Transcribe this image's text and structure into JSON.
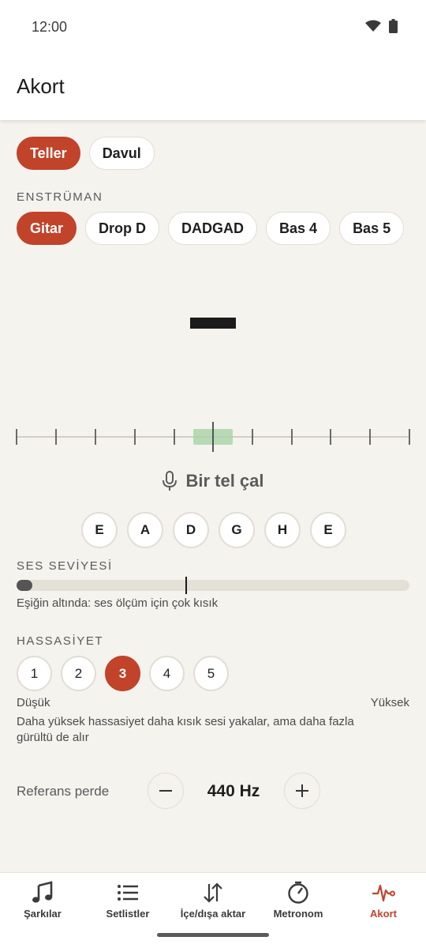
{
  "status_bar": {
    "time": "12:00"
  },
  "app_bar": {
    "title": "Akort"
  },
  "mode_tabs": [
    {
      "label": "Teller",
      "active": true
    },
    {
      "label": "Davul",
      "active": false
    }
  ],
  "instrument": {
    "section_label": "ENSTRÜMAN",
    "options": [
      {
        "label": "Gitar",
        "active": true
      },
      {
        "label": "Drop D",
        "active": false
      },
      {
        "label": "DADGAD",
        "active": false
      },
      {
        "label": "Bas 4",
        "active": false
      },
      {
        "label": "Bas 5",
        "active": false
      }
    ]
  },
  "tuner": {
    "note_display": "",
    "prompt": "Bir tel çal",
    "strings": [
      "E",
      "A",
      "D",
      "G",
      "H",
      "E"
    ]
  },
  "level": {
    "section_label": "SES SEVİYESİ",
    "value_fraction": 0.04,
    "threshold_fraction": 0.43,
    "status": "Eşiğin altında: ses ölçüm için çok kısık"
  },
  "sensitivity": {
    "section_label": "HASSASİYET",
    "options": [
      "1",
      "2",
      "3",
      "4",
      "5"
    ],
    "selected": "3",
    "low_label": "Düşük",
    "high_label": "Yüksek",
    "description": "Daha yüksek hassasiyet daha kısık sesi yakalar, ama daha fazla gürültü de alır"
  },
  "reference": {
    "label": "Referans perde",
    "value": "440 Hz"
  },
  "bottom_nav": [
    {
      "label": "Şarkılar",
      "icon": "music-note-icon",
      "active": false
    },
    {
      "label": "Setlistler",
      "icon": "list-icon",
      "active": false
    },
    {
      "label": "İçe/dışa aktar",
      "icon": "import-export-icon",
      "active": false
    },
    {
      "label": "Metronom",
      "icon": "metronome-icon",
      "active": false
    },
    {
      "label": "Akort",
      "icon": "tuner-wave-icon",
      "active": true
    }
  ],
  "colors": {
    "accent": "#c0432a",
    "in_tune_zone": "#a7d3a6",
    "background": "#f5f3ee"
  }
}
